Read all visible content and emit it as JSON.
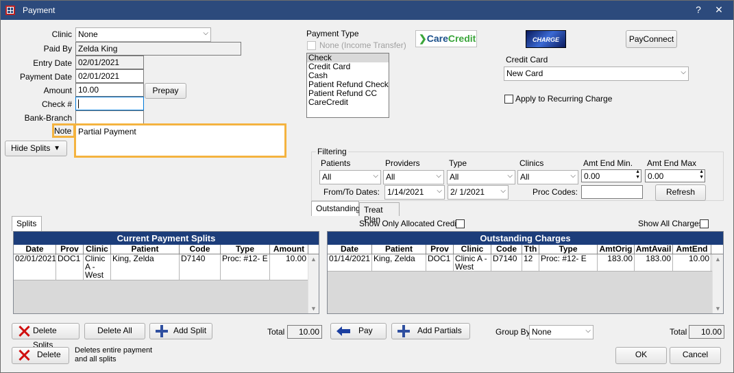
{
  "window": {
    "title": "Payment",
    "help": "?",
    "close": "✕"
  },
  "form": {
    "clinic_label": "Clinic",
    "clinic_value": "None",
    "paid_by_label": "Paid By",
    "paid_by_value": "Zelda King",
    "entry_date_label": "Entry Date",
    "entry_date_value": "02/01/2021",
    "payment_date_label": "Payment Date",
    "payment_date_value": "02/01/2021",
    "amount_label": "Amount",
    "amount_value": "10.00",
    "prepay_label": "Prepay",
    "check_label": "Check #",
    "check_value": "",
    "bank_branch_label": "Bank-Branch",
    "bank_branch_value": "",
    "note_label": "Note",
    "note_value": "Partial Payment",
    "hide_splits_label": "Hide Splits"
  },
  "payment_type": {
    "label": "Payment Type",
    "none_income_label": "None (Income Transfer)",
    "items": [
      "Check",
      "Credit Card",
      "Cash",
      "Patient Refund Check",
      "Patient Refund CC",
      "CareCredit"
    ],
    "selected": "Check"
  },
  "logos": {
    "carecredit_care": "Care",
    "carecredit_credit": "Credit",
    "xcharge": "CHARGE"
  },
  "payconnect_label": "PayConnect",
  "credit_card": {
    "label": "Credit Card",
    "value": "New Card",
    "recurring_label": "Apply to Recurring Charge"
  },
  "filtering": {
    "label": "Filtering",
    "patients_label": "Patients",
    "patients_value": "All",
    "providers_label": "Providers",
    "providers_value": "All",
    "type_label": "Type",
    "type_value": "All",
    "clinics_label": "Clinics",
    "clinics_value": "All",
    "amt_min_label": "Amt End Min.",
    "amt_min_value": "0.00",
    "amt_max_label": "Amt End Max",
    "amt_max_value": "0.00",
    "from_to_label": "From/To Dates:",
    "from_date": "1/14/2021",
    "to_date": "2/  1/2021",
    "proc_codes_label": "Proc Codes:",
    "proc_codes_value": "",
    "refresh_label": "Refresh"
  },
  "tabs": {
    "splits": "Splits",
    "outstanding": "Outstanding",
    "treat_plan": "Treat Plan"
  },
  "options": {
    "show_allocated_label": "Show Only Allocated Credits",
    "show_all_charges_label": "Show All Charges"
  },
  "splits_grid": {
    "title": "Current Payment Splits",
    "columns": [
      "Date",
      "Prov",
      "Clinic",
      "Patient",
      "Code",
      "Type",
      "Amount"
    ],
    "rows": [
      {
        "date": "02/01/2021",
        "prov": "DOC1",
        "clinic": "Clinic A - West",
        "patient": "King, Zelda",
        "code": "D7140",
        "type": "Proc: #12- E",
        "amount": "10.00"
      }
    ]
  },
  "outstanding_grid": {
    "title": "Outstanding Charges",
    "columns": [
      "Date",
      "Patient",
      "Prov",
      "Clinic",
      "Code",
      "Tth",
      "Type",
      "AmtOrig",
      "AmtAvail",
      "AmtEnd"
    ],
    "rows": [
      {
        "date": "01/14/2021",
        "patient": "King, Zelda",
        "prov": "DOC1",
        "clinic": "Clinic A - West",
        "code": "D7140",
        "tth": "12",
        "type": "Proc: #12- E",
        "amt_orig": "183.00",
        "amt_avail": "183.00",
        "amt_end": "10.00"
      }
    ]
  },
  "bottom": {
    "delete_splits_label": "Delete Splits",
    "delete_all_label": "Delete All",
    "add_split_label": "Add Split",
    "total_label": "Total",
    "splits_total": "10.00",
    "pay_label": "Pay",
    "add_partials_label": "Add Partials",
    "group_by_label": "Group By",
    "group_by_value": "None",
    "outstanding_total": "10.00",
    "delete_label": "Delete",
    "delete_desc": "Deletes entire payment and all splits",
    "ok_label": "OK",
    "cancel_label": "Cancel"
  }
}
